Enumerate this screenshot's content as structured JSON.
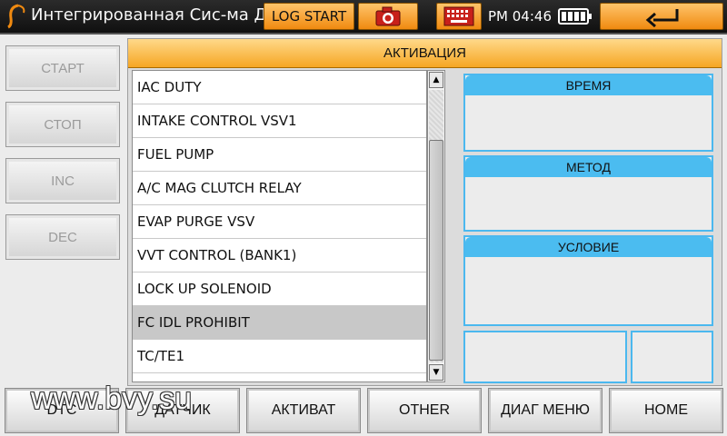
{
  "header": {
    "app_title": "Интегрированная Сис-ма Ди",
    "log_button": "LOG START",
    "camera_icon": "camera-icon",
    "keyboard_icon": "keyboard-icon",
    "clock": "PM 04:46",
    "battery_level": 1.0,
    "back_icon": "back-arrow-icon"
  },
  "sidebar": {
    "buttons": [
      "СТАРТ",
      "СТОП",
      "INC",
      "DEC"
    ]
  },
  "panel": {
    "title": "АКТИВАЦИЯ",
    "items": [
      "IAC DUTY",
      "INTAKE CONTROL VSV1",
      "FUEL PUMP",
      "A/C MAG CLUTCH RELAY",
      "EVAP PURGE VSV",
      "VVT CONTROL (BANK1)",
      "LOCK UP SOLENOID",
      "FC IDL PROHIBIT",
      "TC/TE1"
    ],
    "selected_item": "FC IDL PROHIBIT",
    "info": {
      "time_label": "ВРЕМЯ",
      "method_label": "МЕТОД",
      "condition_label": "УСЛОВИЕ"
    }
  },
  "bottom": {
    "buttons": [
      "DTC",
      "ДАТЧИК",
      "АКТИВАТ",
      "OTHER",
      "ДИАГ МЕНЮ",
      "HOME"
    ]
  },
  "watermark": "www.bvy.su",
  "colors": {
    "accent_orange": "#f6a623",
    "info_blue": "#4bbcf0",
    "topbar": "#1a1a1a"
  }
}
